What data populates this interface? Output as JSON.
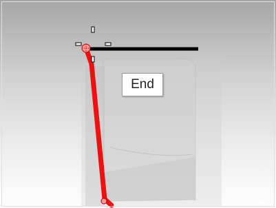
{
  "viewport": {
    "osnap_tooltip": {
      "label": "End"
    }
  },
  "colors": {
    "viewport_top": "#a6a6a6",
    "viewport_bottom": "#ffffff",
    "selected_curve": "#ee1111",
    "black_line": "#000000",
    "grip_marker": "#000000"
  },
  "icons": {
    "cursor": "crosshair-cursor-icon",
    "snap_target": "snap-target-icon"
  }
}
